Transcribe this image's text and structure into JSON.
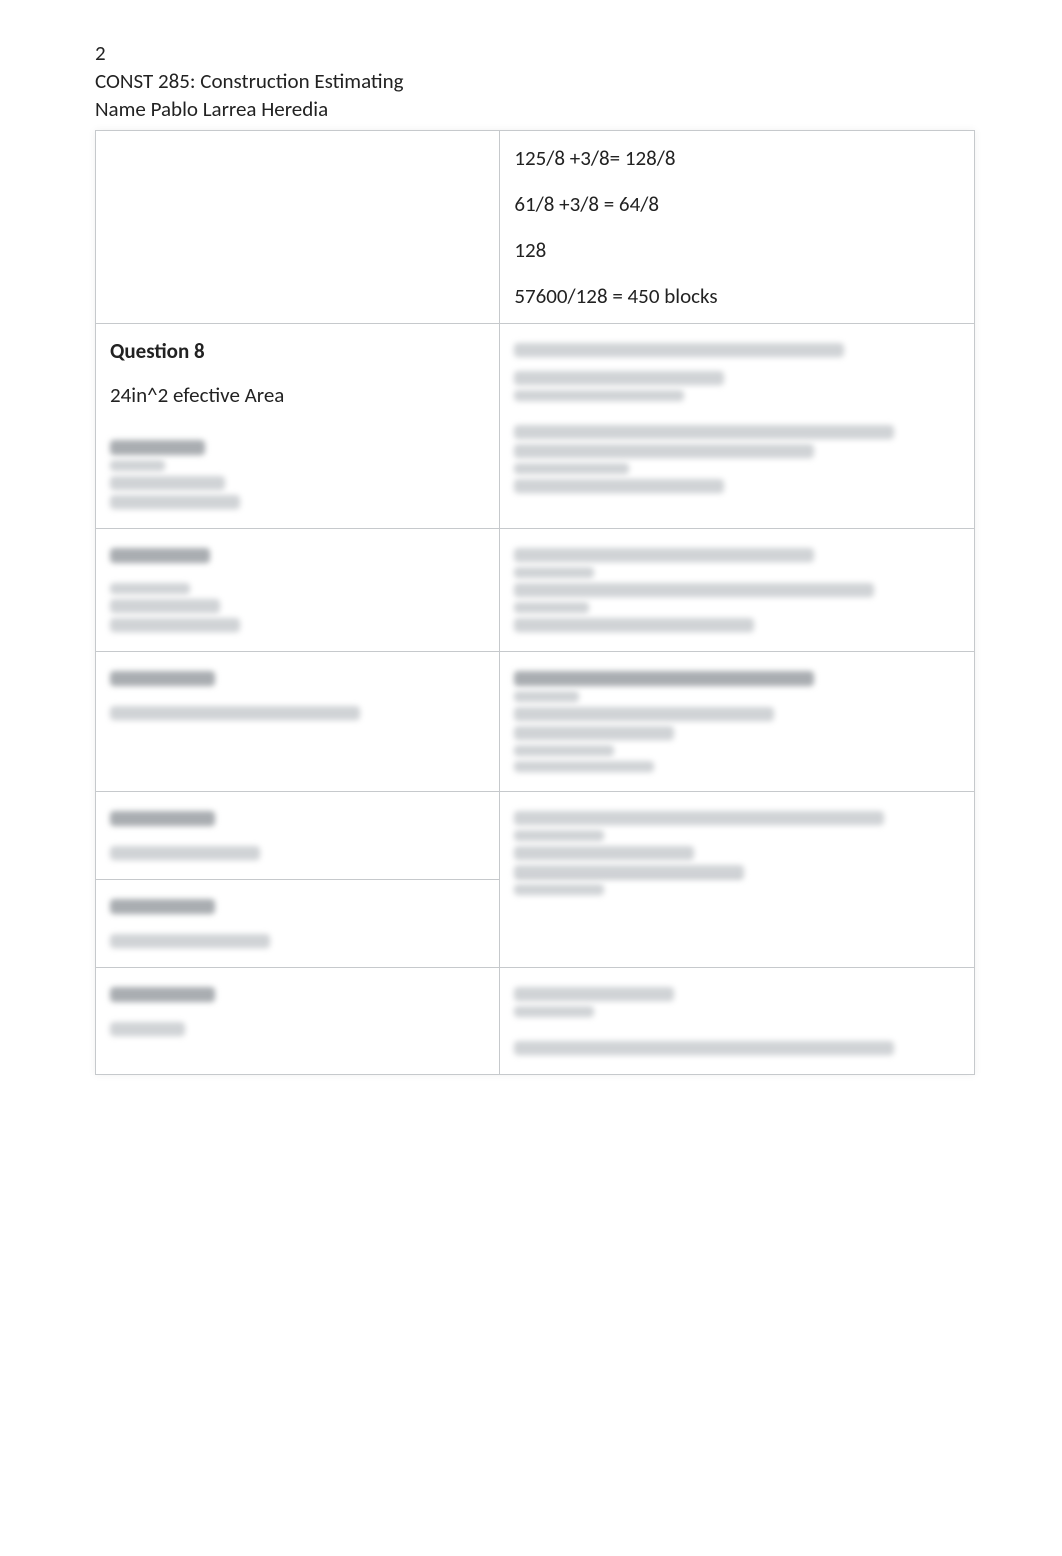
{
  "header": {
    "page_number": "2",
    "course": "CONST 285: Construction Estimating",
    "name_line": "Name Pablo Larrea Heredia"
  },
  "rows": [
    {
      "left": {
        "question": "",
        "text": ""
      },
      "right": {
        "lines": [
          "125/8 +3/8= 128/8",
          "61/8 +3/8  = 64/8",
          "128",
          "57600/128 = 450 blocks"
        ]
      }
    },
    {
      "left": {
        "question": "Question 8",
        "text": "24in^2 efective Area"
      },
      "right": {
        "lines": []
      }
    }
  ],
  "blur_placeholder": ""
}
